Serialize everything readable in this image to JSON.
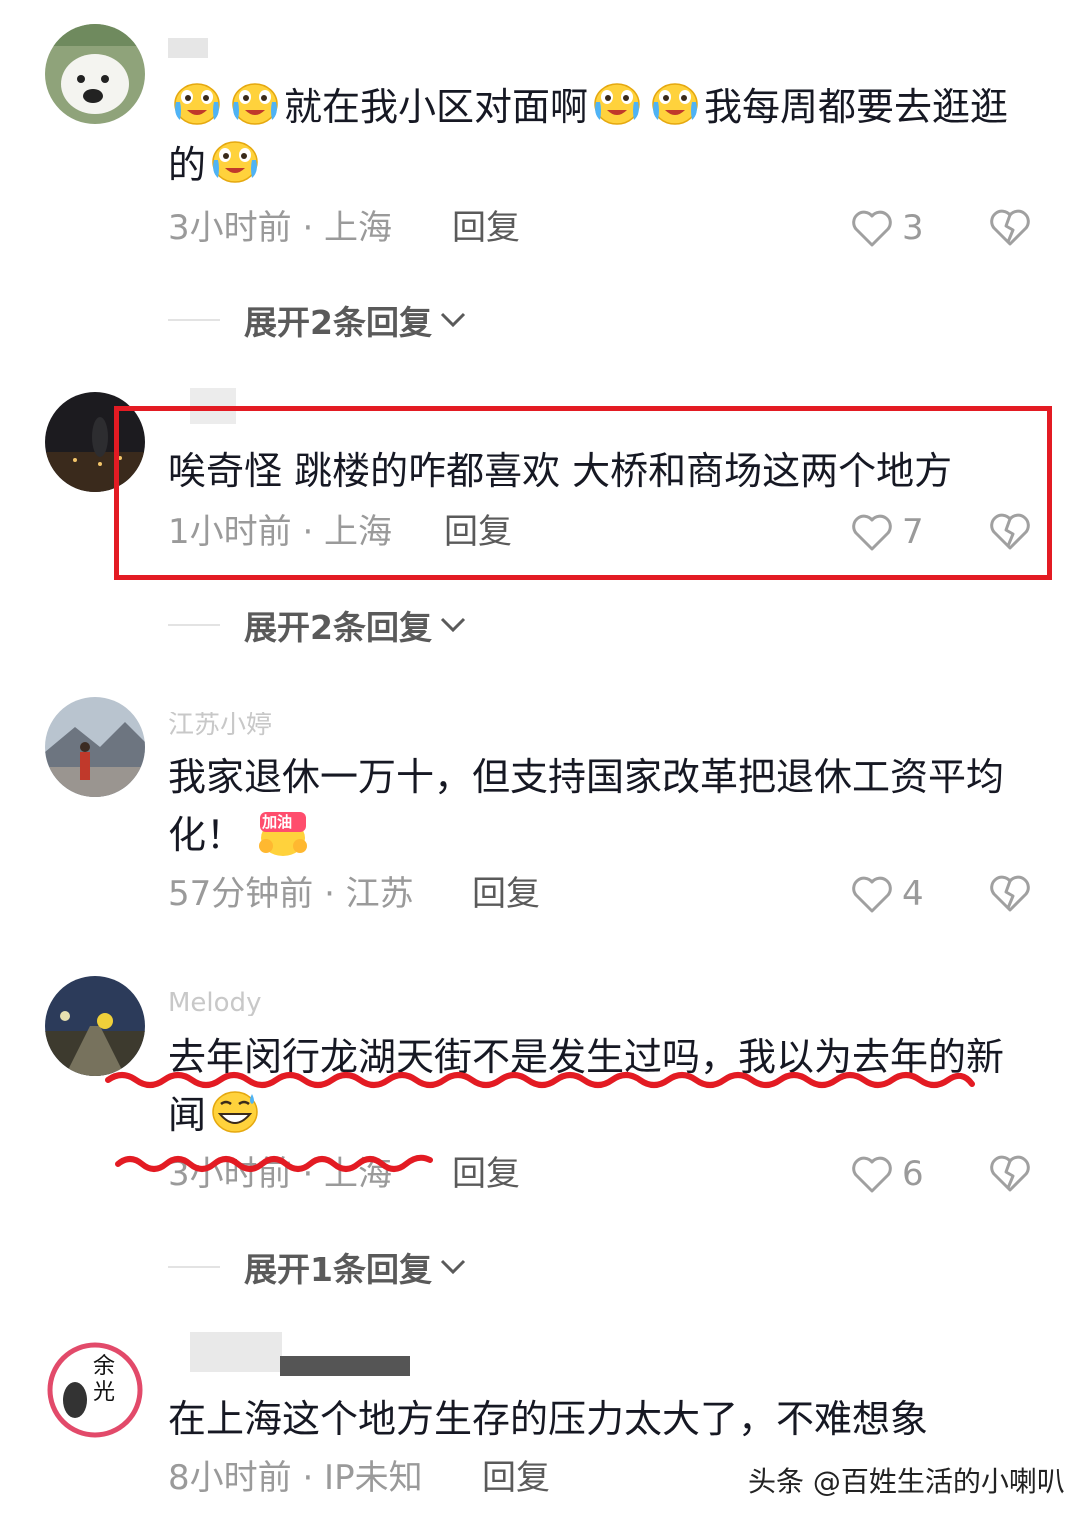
{
  "comments": [
    {
      "text_a": "就在我小区对面啊",
      "text_b": "我每周都要去逛逛的",
      "emoji": "crying-laughing-emoji",
      "meta": "3小时前 · 上海",
      "reply": "回复",
      "likes": "3"
    },
    {
      "text": "唉奇怪 跳楼的咋都喜欢 大桥和商场这两个地方",
      "meta": "1小时前 · 上海",
      "reply": "回复",
      "likes": "7"
    },
    {
      "username": "江苏小婷",
      "text": "我家退休一万十，但支持国家改革把退休工资平均化！",
      "sticker": "加油",
      "meta": "57分钟前 · 江苏",
      "reply": "回复",
      "likes": "4"
    },
    {
      "username": "Melody",
      "text": "去年闵行龙湖天街不是发生过吗，我以为去年的新闻",
      "emoji": "grinning-sweat-emoji",
      "meta": "3小时前 · 上海",
      "reply": "回复",
      "likes": "6"
    },
    {
      "text": "在上海这个地方生存的压力太大了，不难想象",
      "avatar_text": "余光",
      "meta": "8小时前 · IP未知",
      "reply": "回复"
    }
  ],
  "expand_replies": [
    "展开2条回复",
    "展开2条回复",
    "展开1条回复"
  ],
  "watermark": "头条 @百姓生活的小喇叭",
  "colors": {
    "highlight": "#e31b23",
    "annotation": "#e31b23",
    "meta": "#9a9a9a"
  }
}
